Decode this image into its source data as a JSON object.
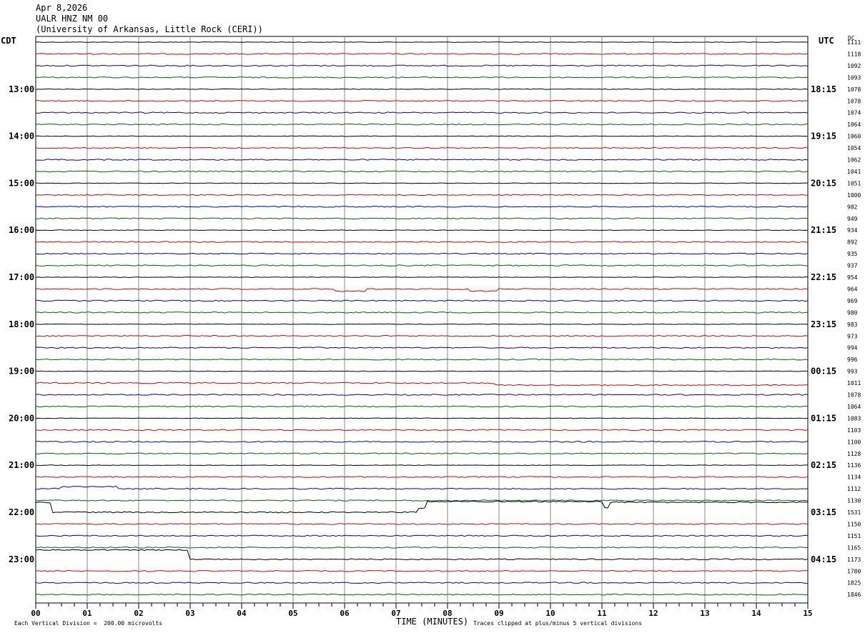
{
  "header": {
    "date": "Apr 8,2026",
    "station": "UALR HNZ NM 00",
    "institution": "(University of Arkansas, Little Rock (CERI))"
  },
  "left_tz": "CDT",
  "right_tz": "UTC",
  "dc_label": "DC",
  "footer": {
    "scale": "Each Vertical Division =  200.00 microvolts",
    "clip": "Traces clipped at plus/minus 5 vertical divisions"
  },
  "colors": {
    "trace_cycle": [
      "#000000",
      "#dd0000",
      "#0000cc",
      "#006600"
    ],
    "grid": "#000000"
  },
  "chart_data": {
    "type": "line",
    "title": "",
    "xlabel": "TIME (MINUTES)",
    "ylabel": "",
    "x_ticks": [
      "00",
      "01",
      "02",
      "03",
      "04",
      "05",
      "06",
      "07",
      "08",
      "09",
      "10",
      "11",
      "12",
      "13",
      "14",
      "15"
    ],
    "xlim": [
      0,
      15
    ],
    "left_hour_labels": [
      "13:00",
      "14:00",
      "15:00",
      "16:00",
      "17:00",
      "18:00",
      "19:00",
      "20:00",
      "21:00",
      "22:00",
      "23:00"
    ],
    "right_hour_labels": [
      "18:15",
      "19:15",
      "20:15",
      "21:15",
      "22:15",
      "23:15",
      "00:15",
      "01:15",
      "02:15",
      "03:15",
      "04:15"
    ],
    "dc_offsets": [
      "1111",
      "1118",
      "1092",
      "1093",
      "1078",
      "1078",
      "1074",
      "1064",
      "1060",
      "1054",
      "1062",
      "1041",
      "1051",
      "1000",
      "982",
      "949",
      "934",
      "892",
      "935",
      "937",
      "954",
      "964",
      "969",
      "980",
      "983",
      "973",
      "994",
      "996",
      "993",
      "1011",
      "1078",
      "1064",
      "1083",
      "1103",
      "1100",
      "1128",
      "1136",
      "1134",
      "1112",
      "1130",
      "1531",
      "1150",
      "1151",
      "1165",
      "1173",
      "1780",
      "1825",
      "1846"
    ],
    "trace_minutes_per_line": 15,
    "events": [
      {
        "trace": 21,
        "minute": 5.8,
        "shape": "dip"
      },
      {
        "trace": 21,
        "minute": 8.4,
        "shape": "dip"
      },
      {
        "trace": 29,
        "minute": 8.9,
        "shape": "step_down"
      },
      {
        "trace": 38,
        "minute": 0.5,
        "shape": "bump"
      },
      {
        "trace": 40,
        "minute": 0.3,
        "shape": "step_down"
      },
      {
        "trace": 40,
        "minute": 7.4,
        "shape": "step_up"
      },
      {
        "trace": 40,
        "minute": 11.05,
        "shape": "spike"
      },
      {
        "trace": 44,
        "minute": 2.95,
        "shape": "step_down"
      }
    ]
  }
}
